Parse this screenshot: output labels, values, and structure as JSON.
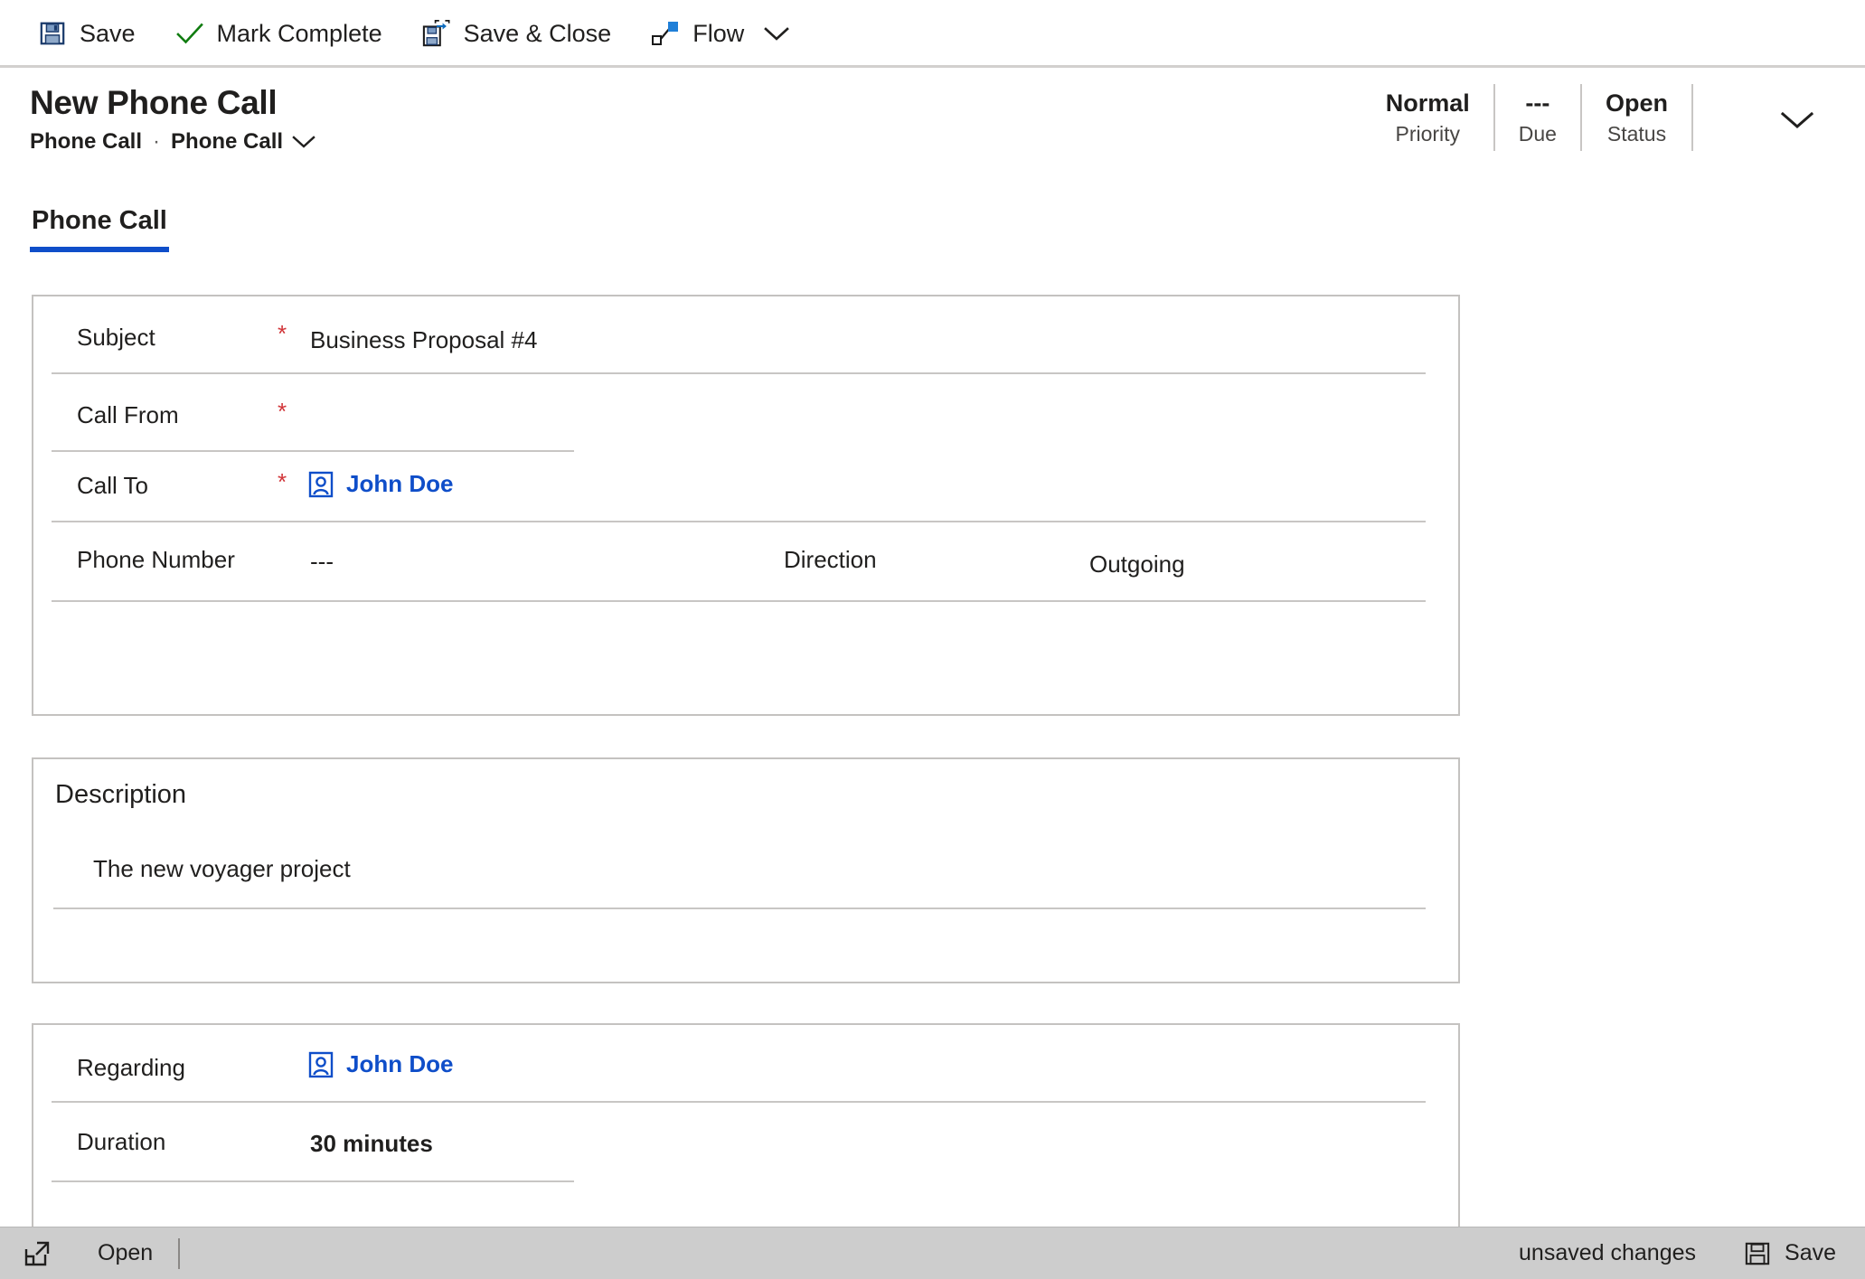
{
  "command_bar": {
    "buttons": [
      {
        "label": "Save",
        "icon": "save-floppy-icon"
      },
      {
        "label": "Mark Complete",
        "icon": "checkmark-icon"
      },
      {
        "label": "Save & Close",
        "icon": "save-and-close-icon"
      },
      {
        "label": "Flow",
        "icon": "flow-icon"
      }
    ],
    "overflow_icon": "chevron-down-icon"
  },
  "record_header": {
    "title": "New Phone Call",
    "entity_name": "Phone Call",
    "separator": "·",
    "form_name": "Phone Call",
    "form_chevron": "chevron-down-icon",
    "collapse_icon": "chevron-down-icon",
    "stats": [
      {
        "value": "Normal",
        "label": "Priority"
      },
      {
        "value": "---",
        "label": "Due"
      },
      {
        "value": "Open",
        "label": "Status"
      }
    ]
  },
  "tabs": [
    {
      "label": "Phone Call",
      "selected": true
    }
  ],
  "main_section": {
    "fields": [
      {
        "label": "Subject",
        "required": true,
        "value": "Business Proposal #4",
        "type": "text"
      },
      {
        "label": "Call From",
        "required": true,
        "value": "",
        "type": "lookup"
      },
      {
        "label": "Call To",
        "required": true,
        "value": "John Doe",
        "type": "lookup",
        "icon": "contact-card-icon"
      },
      {
        "label": "Phone Number",
        "required": false,
        "value": "---",
        "type": "text"
      },
      {
        "label": "Direction",
        "required": false,
        "value": "Outgoing",
        "type": "text"
      }
    ]
  },
  "description_section": {
    "heading": "Description",
    "value": "The new voyager project"
  },
  "regarding_section": {
    "fields": [
      {
        "label": "Regarding",
        "required": false,
        "value": "John Doe",
        "type": "lookup",
        "icon": "contact-card-icon"
      },
      {
        "label": "Duration",
        "required": false,
        "value": "30 minutes",
        "type": "text"
      }
    ]
  },
  "footer": {
    "open_icon": "open-in-new-window-icon",
    "open_label": "Open",
    "status_text": "unsaved changes",
    "save_label": "Save",
    "save_icon": "save-floppy-icon"
  },
  "colors": {
    "accent_blue": "#0f4ec9",
    "required_red": "#d13438",
    "footer_gray": "#cdcdcd",
    "divider_gray": "#c8c6c4",
    "card_border": "#c4c2c0"
  }
}
